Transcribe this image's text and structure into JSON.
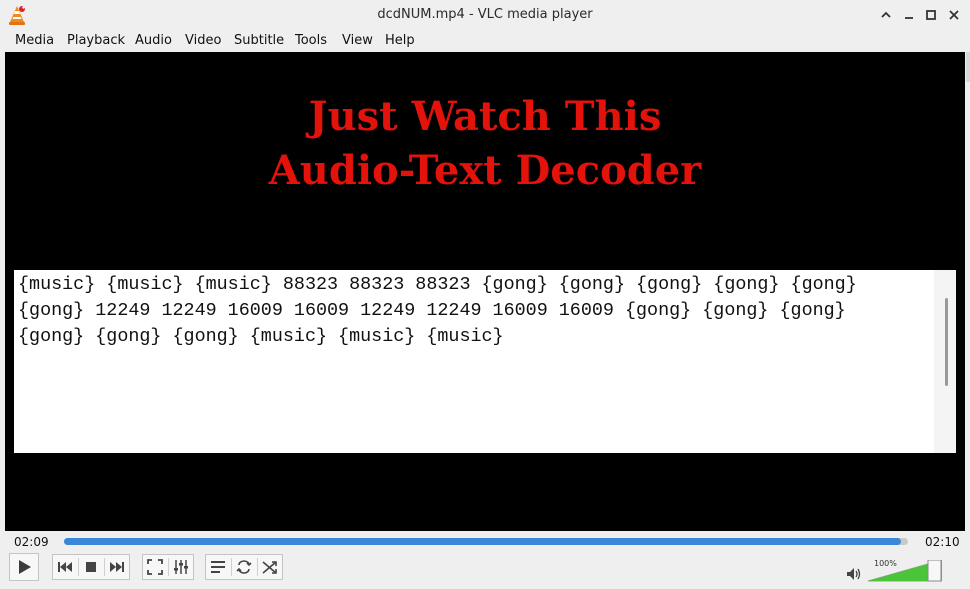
{
  "window": {
    "title": "dcdNUM.mp4 - VLC media player",
    "controls": [
      "chevron-up-icon",
      "minimize-icon",
      "maximize-icon",
      "close-icon"
    ]
  },
  "menu": [
    {
      "label": "Media"
    },
    {
      "label": "Playback"
    },
    {
      "label": "Audio"
    },
    {
      "label": "Video"
    },
    {
      "label": "Subtitle"
    },
    {
      "label": "Tools"
    },
    {
      "label": "View"
    },
    {
      "label": "Help"
    }
  ],
  "video": {
    "title_line1": "Just Watch This",
    "title_line2": "Audio-Text Decoder",
    "title_color": "#e3120b",
    "decoded_text": "{music} {music} {music} 88323 88323 88323 {gong} {gong} {gong} {gong} {gong} {gong} 12249 12249 16009 16009 12249 12249 16009 16009 {gong} {gong} {gong} {gong} {gong} {gong} {music} {music} {music}"
  },
  "player": {
    "elapsed": "02:09",
    "total": "02:10",
    "progress_fraction": 0.992,
    "accent_color": "#3a87d8",
    "volume_label": "100%",
    "volume_fraction": 1.0
  },
  "controls": [
    "play-icon",
    "previous-icon",
    "stop-icon",
    "next-icon",
    "fullscreen-icon",
    "extended-settings-icon",
    "playlist-icon",
    "loop-icon",
    "shuffle-icon",
    "volume-icon"
  ]
}
